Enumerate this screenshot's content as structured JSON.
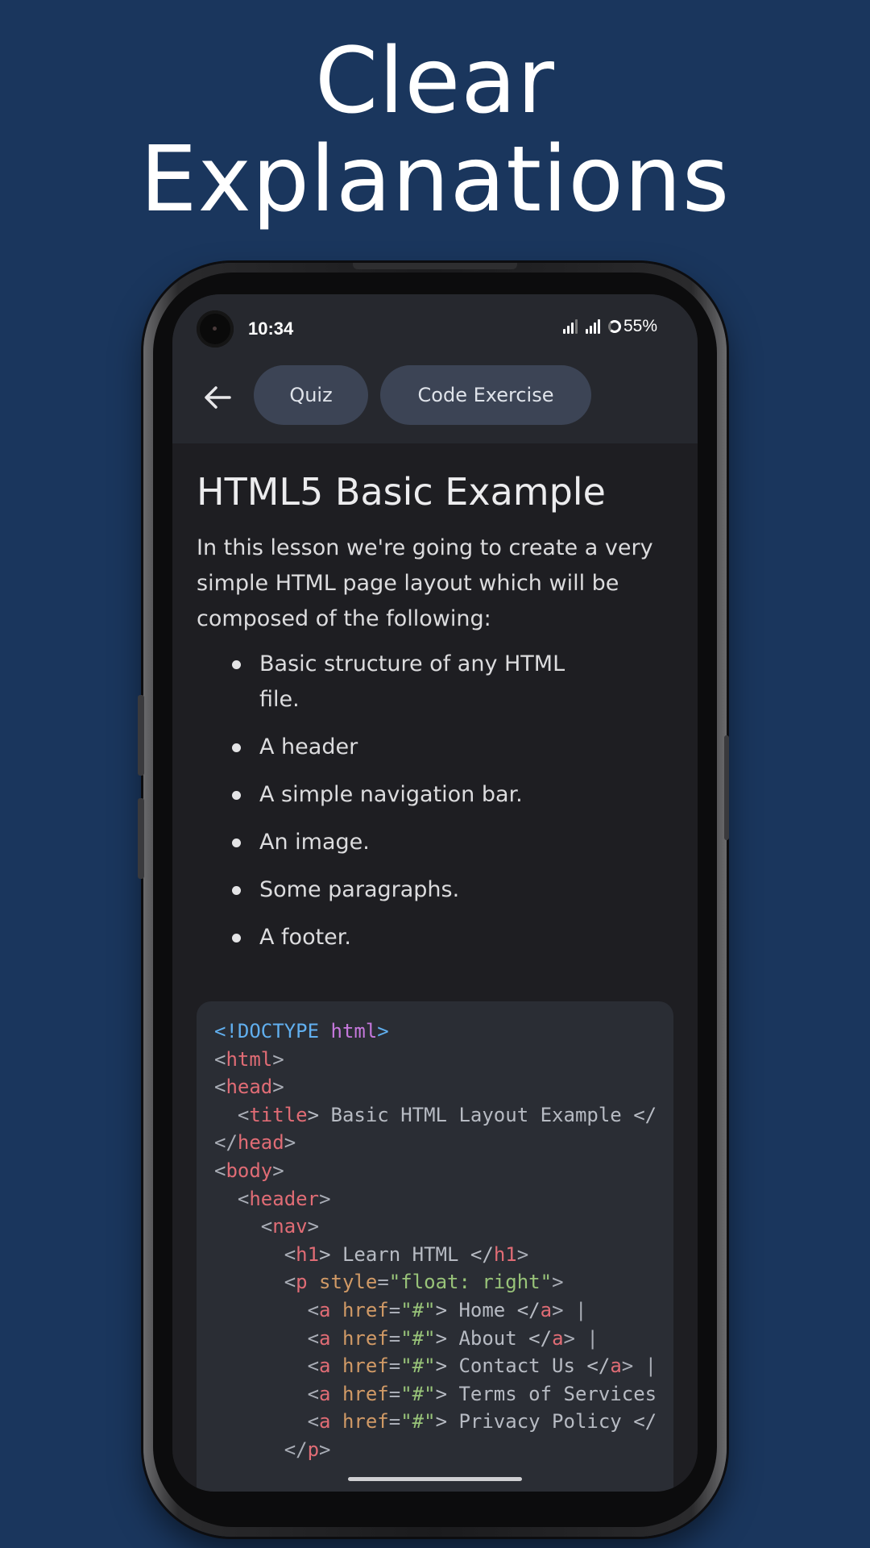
{
  "headline": {
    "line1": "Clear",
    "line2": "Explanations"
  },
  "status_bar": {
    "time": "10:34",
    "battery": "55%"
  },
  "toolbar": {
    "back_icon": "arrow-left-icon",
    "tabs": [
      {
        "label": "Quiz"
      },
      {
        "label": "Code Exercise"
      }
    ]
  },
  "lesson": {
    "title": "HTML5 Basic Example",
    "intro": "In this lesson we're going to create a very simple HTML page layout which will be composed of the following:",
    "bullets": [
      "Basic structure of any HTML file.",
      "A header",
      "A simple navigation bar.",
      "An image.",
      "Some paragraphs.",
      "A footer."
    ]
  },
  "code": {
    "lines": [
      [
        {
          "t": "<!DOCTYPE ",
          "c": "doctype"
        },
        {
          "t": "html",
          "c": "kw"
        },
        {
          "t": ">",
          "c": "doctype"
        }
      ],
      [
        {
          "t": "<",
          "c": "p"
        },
        {
          "t": "html",
          "c": "tag"
        },
        {
          "t": ">",
          "c": "p"
        }
      ],
      [
        {
          "t": "<",
          "c": "p"
        },
        {
          "t": "head",
          "c": "tag"
        },
        {
          "t": ">",
          "c": "p"
        }
      ],
      [
        {
          "t": "  <",
          "c": "p"
        },
        {
          "t": "title",
          "c": "tag"
        },
        {
          "t": "> Basic HTML Layout Example </",
          "c": "text"
        }
      ],
      [
        {
          "t": "</",
          "c": "p"
        },
        {
          "t": "head",
          "c": "tag"
        },
        {
          "t": ">",
          "c": "p"
        }
      ],
      [
        {
          "t": "<",
          "c": "p"
        },
        {
          "t": "body",
          "c": "tag"
        },
        {
          "t": ">",
          "c": "p"
        }
      ],
      [
        {
          "t": "  <",
          "c": "p"
        },
        {
          "t": "header",
          "c": "tag"
        },
        {
          "t": ">",
          "c": "p"
        }
      ],
      [
        {
          "t": "    <",
          "c": "p"
        },
        {
          "t": "nav",
          "c": "tag"
        },
        {
          "t": ">",
          "c": "p"
        }
      ],
      [
        {
          "t": "      <",
          "c": "p"
        },
        {
          "t": "h1",
          "c": "tag"
        },
        {
          "t": "> Learn HTML </",
          "c": "text"
        },
        {
          "t": "h1",
          "c": "tag"
        },
        {
          "t": ">",
          "c": "p"
        }
      ],
      [
        {
          "t": "      <",
          "c": "p"
        },
        {
          "t": "p",
          "c": "tag"
        },
        {
          "t": " style",
          "c": "attr"
        },
        {
          "t": "=",
          "c": "p"
        },
        {
          "t": "\"float: right\"",
          "c": "str"
        },
        {
          "t": ">",
          "c": "p"
        }
      ],
      [
        {
          "t": "        <",
          "c": "p"
        },
        {
          "t": "a",
          "c": "tag"
        },
        {
          "t": " href",
          "c": "attr"
        },
        {
          "t": "=",
          "c": "p"
        },
        {
          "t": "\"#\"",
          "c": "str"
        },
        {
          "t": "> Home </",
          "c": "text"
        },
        {
          "t": "a",
          "c": "tag"
        },
        {
          "t": "> |",
          "c": "p"
        }
      ],
      [
        {
          "t": "        <",
          "c": "p"
        },
        {
          "t": "a",
          "c": "tag"
        },
        {
          "t": " href",
          "c": "attr"
        },
        {
          "t": "=",
          "c": "p"
        },
        {
          "t": "\"#\"",
          "c": "str"
        },
        {
          "t": "> About </",
          "c": "text"
        },
        {
          "t": "a",
          "c": "tag"
        },
        {
          "t": "> |",
          "c": "p"
        }
      ],
      [
        {
          "t": "        <",
          "c": "p"
        },
        {
          "t": "a",
          "c": "tag"
        },
        {
          "t": " href",
          "c": "attr"
        },
        {
          "t": "=",
          "c": "p"
        },
        {
          "t": "\"#\"",
          "c": "str"
        },
        {
          "t": "> Contact Us </",
          "c": "text"
        },
        {
          "t": "a",
          "c": "tag"
        },
        {
          "t": "> |",
          "c": "p"
        }
      ],
      [
        {
          "t": "        <",
          "c": "p"
        },
        {
          "t": "a",
          "c": "tag"
        },
        {
          "t": " href",
          "c": "attr"
        },
        {
          "t": "=",
          "c": "p"
        },
        {
          "t": "\"#\"",
          "c": "str"
        },
        {
          "t": "> Terms of Services",
          "c": "text"
        }
      ],
      [
        {
          "t": "        <",
          "c": "p"
        },
        {
          "t": "a",
          "c": "tag"
        },
        {
          "t": " href",
          "c": "attr"
        },
        {
          "t": "=",
          "c": "p"
        },
        {
          "t": "\"#\"",
          "c": "str"
        },
        {
          "t": "> Privacy Policy </",
          "c": "text"
        }
      ],
      [
        {
          "t": "      </",
          "c": "p"
        },
        {
          "t": "p",
          "c": "tag"
        },
        {
          "t": ">",
          "c": "p"
        }
      ]
    ]
  },
  "colors": {
    "background": "#1a365d",
    "screen": "#1e1e22",
    "toolbar": "#26282e",
    "chip": "#3c4455",
    "code_bg": "#2a2d34"
  }
}
